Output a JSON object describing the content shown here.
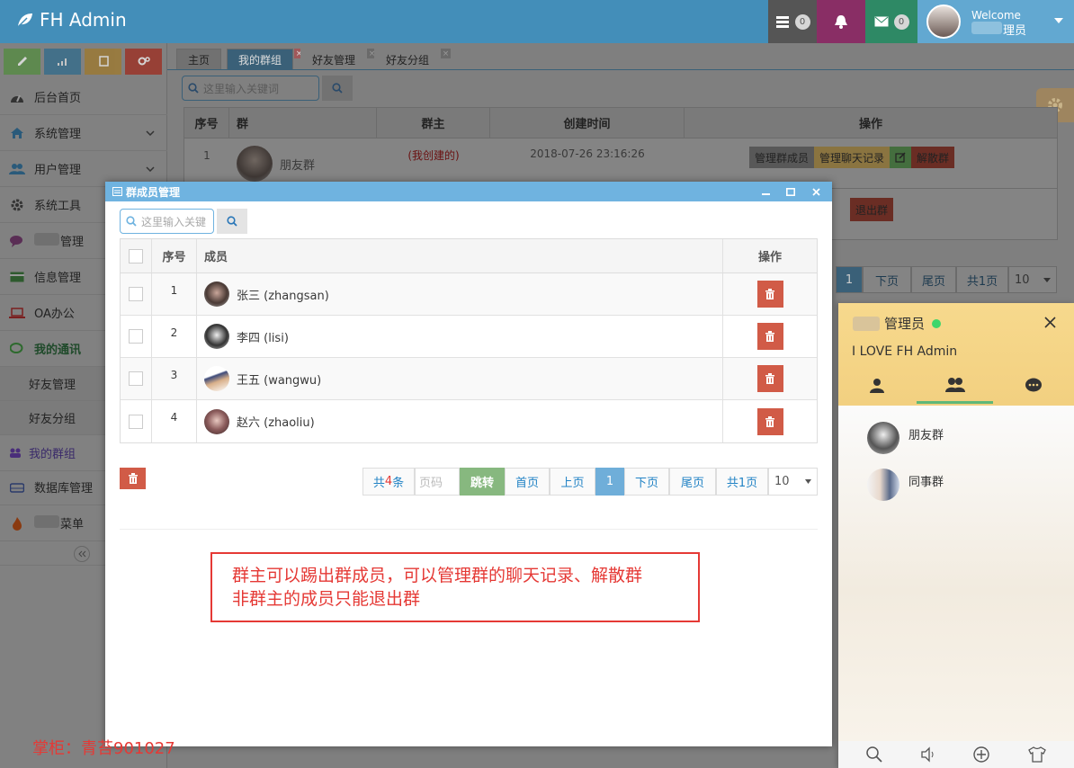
{
  "app": {
    "title": "FH Admin"
  },
  "navbar": {
    "badge_tasks": "0",
    "badge_messages": "0",
    "welcome": "Welcome",
    "username_visible": "理员"
  },
  "sidebar": {
    "items": [
      {
        "label": "后台首页",
        "icon": "tachometer-icon"
      },
      {
        "label": "系统管理",
        "icon": "home-icon"
      },
      {
        "label": "用户管理",
        "icon": "users-icon"
      },
      {
        "label": "系统工具",
        "icon": "cog-icon"
      },
      {
        "label": "管理",
        "icon": "comments-icon"
      },
      {
        "label": "信息管理",
        "icon": "credit-card-icon"
      },
      {
        "label": "OA办公",
        "icon": "laptop-icon"
      },
      {
        "label": "我的通讯",
        "icon": "chat-icon"
      }
    ],
    "subitems": [
      "好友管理",
      "好友分组"
    ],
    "items2": [
      {
        "label": "我的群组",
        "icon": "group-icon"
      },
      {
        "label": "数据库管理",
        "icon": "hdd-icon"
      },
      {
        "label": "菜单",
        "icon": "fire-icon"
      }
    ]
  },
  "tabs": [
    "主页",
    "我的群组",
    "好友管理",
    "好友分组"
  ],
  "groups": {
    "search_placeholder": "这里输入关键词",
    "headers": [
      "序号",
      "群",
      "群主",
      "创建时间",
      "操作"
    ],
    "rows": [
      {
        "no": "1",
        "name": "朋友群",
        "owner": "(我创建的)",
        "created": "2018-07-26 23:16:26",
        "actions": [
          "管理群成员",
          "管理聊天记录",
          "解散群"
        ]
      }
    ],
    "row2_action": "退出群",
    "pagination": {
      "current": "1",
      "next": "下页",
      "last": "尾页",
      "total_pages": "共1页",
      "page_size": "10"
    }
  },
  "modal": {
    "title": "群成员管理",
    "search_placeholder": "这里输入关键",
    "headers": [
      "序号",
      "成员",
      "操作"
    ],
    "members": [
      {
        "no": "1",
        "name": "张三 (zhangsan)"
      },
      {
        "no": "2",
        "name": "李四 (lisi)"
      },
      {
        "no": "3",
        "name": "王五 (wangwu)"
      },
      {
        "no": "4",
        "name": "赵六 (zhaoliu)"
      }
    ],
    "pagination": {
      "total_prefix": "共",
      "total_count": "4",
      "total_suffix": "条",
      "page_input_placeholder": "页码",
      "jump": "跳转",
      "first": "首页",
      "prev": "上页",
      "current": "1",
      "next": "下页",
      "last": "尾页",
      "total_pages": "共1页",
      "page_size": "10"
    }
  },
  "note": {
    "line1": "群主可以踢出群成员，可以管理群的聊天记录、解散群",
    "line2": "非群主的成员只能退出群"
  },
  "chat": {
    "username": "管理员",
    "signature": "I LOVE FH Admin",
    "groups": [
      "朋友群",
      "同事群"
    ],
    "status_color": "#3ed66b"
  },
  "watermark": "掌柜：青苔901027",
  "colors": {
    "navbar": "#438eb9",
    "danger": "#d15b47",
    "primary": "#6fb3e0",
    "success": "#87b87f"
  }
}
